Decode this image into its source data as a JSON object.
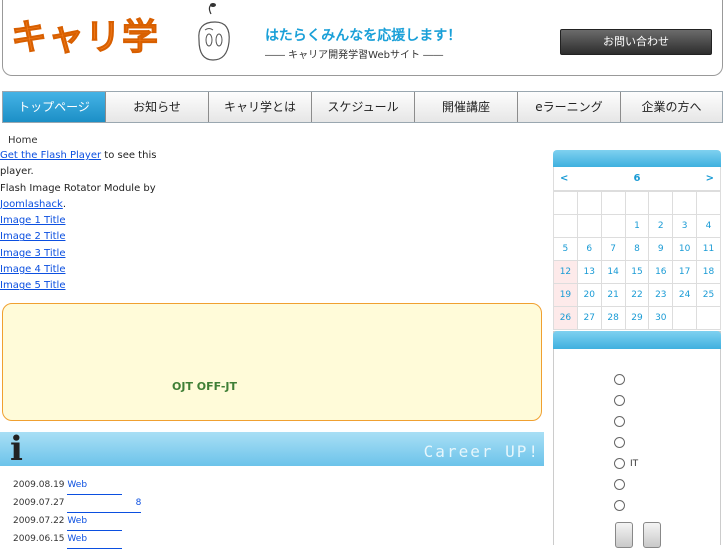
{
  "header": {
    "logo_text": "キャリ学",
    "tagline": "はたらくみんなを応援します！",
    "subtagline": "―― キャリア開発学習Webサイト ――",
    "contact_label": "お問い合わせ"
  },
  "nav": {
    "items": [
      {
        "label": "トップページ"
      },
      {
        "label": "お知らせ"
      },
      {
        "label": "キャリ学とは"
      },
      {
        "label": "スケジュール"
      },
      {
        "label": "開催講座"
      },
      {
        "label": "eラーニング"
      },
      {
        "label": "企業の方へ"
      }
    ]
  },
  "breadcrumb": "Home",
  "flash": {
    "get_link": "Get the Flash Player",
    "text1": " to see this",
    "text2": "player.",
    "text3": "Flash Image Rotator Module by",
    "joomla_link": "Joomlashack",
    "joomla_suffix": ".",
    "images": [
      "Image 1 Title",
      "Image 2 Title",
      "Image 3 Title",
      "Image 4 Title",
      "Image 5 Title"
    ]
  },
  "feature": {
    "text": "OJT  OFF-JT"
  },
  "info": {
    "icon_letter": "i",
    "banner_text": "Career UP!"
  },
  "news": [
    {
      "date": "2009.08.19",
      "link": "Web"
    },
    {
      "date": "2009.07.27",
      "link": "8"
    },
    {
      "date": "2009.07.22",
      "link": "Web"
    },
    {
      "date": "2009.06.15",
      "link": "Web"
    }
  ],
  "calendar": {
    "prev": "<",
    "month": "6",
    "next": ">",
    "weeks": [
      [
        "",
        "",
        "",
        "",
        "",
        "",
        ""
      ],
      [
        "",
        "",
        "",
        "1",
        "2",
        "3",
        "4"
      ],
      [
        "5",
        "6",
        "7",
        "8",
        "9",
        "10",
        "11"
      ],
      [
        "12",
        "13",
        "14",
        "15",
        "16",
        "17",
        "18"
      ],
      [
        "19",
        "20",
        "21",
        "22",
        "23",
        "24",
        "25"
      ],
      [
        "26",
        "27",
        "28",
        "29",
        "30",
        "",
        ""
      ]
    ]
  },
  "poll": {
    "options": [
      "",
      "",
      "",
      "",
      "IT",
      "",
      ""
    ]
  },
  "colors": {
    "accent_blue": "#1aa0d8",
    "logo_orange": "#f07a1a",
    "feature_border": "#f0a030",
    "feature_bg": "#fffbd9"
  }
}
